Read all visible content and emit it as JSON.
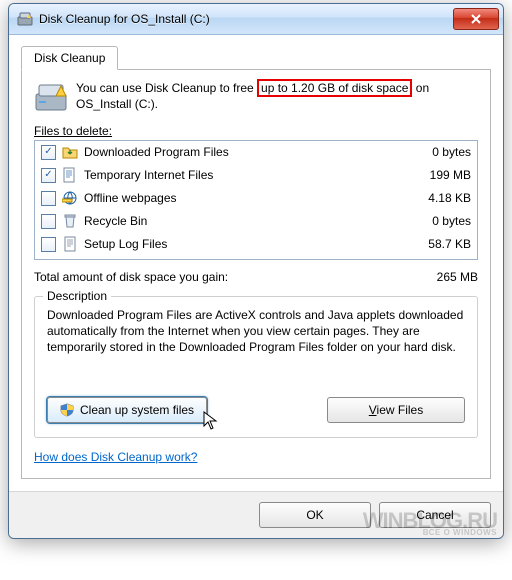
{
  "window": {
    "title": "Disk Cleanup for OS_Install (C:)"
  },
  "tab_label": "Disk Cleanup",
  "intro": {
    "prefix": "You can use Disk Cleanup to free ",
    "highlight": "up to 1.20 GB of disk space",
    "suffix": " on OS_Install (C:)."
  },
  "files_label": "Files to delete:",
  "rows": [
    {
      "checked": true,
      "icon": "folder-download-icon",
      "label": "Downloaded Program Files",
      "size": "0 bytes"
    },
    {
      "checked": true,
      "icon": "internet-file-icon",
      "label": "Temporary Internet Files",
      "size": "199 MB"
    },
    {
      "checked": false,
      "icon": "offline-web-icon",
      "label": "Offline webpages",
      "size": "4.18 KB"
    },
    {
      "checked": false,
      "icon": "recycle-bin-icon",
      "label": "Recycle Bin",
      "size": "0 bytes"
    },
    {
      "checked": false,
      "icon": "setup-log-icon",
      "label": "Setup Log Files",
      "size": "58.7 KB"
    }
  ],
  "total": {
    "label": "Total amount of disk space you gain:",
    "value": "265 MB"
  },
  "description": {
    "title": "Description",
    "text": "Downloaded Program Files are ActiveX controls and Java applets downloaded automatically from the Internet when you view certain pages. They are temporarily stored in the Downloaded Program Files folder on your hard disk."
  },
  "buttons": {
    "cleanup_system": "Clean up system files",
    "view_files": "View Files",
    "ok": "OK",
    "cancel": "Cancel"
  },
  "link": "How does Disk Cleanup work?",
  "watermark": {
    "line1": "WINBLOG.RU",
    "line2": "ВСЕ О WINDOWS"
  }
}
